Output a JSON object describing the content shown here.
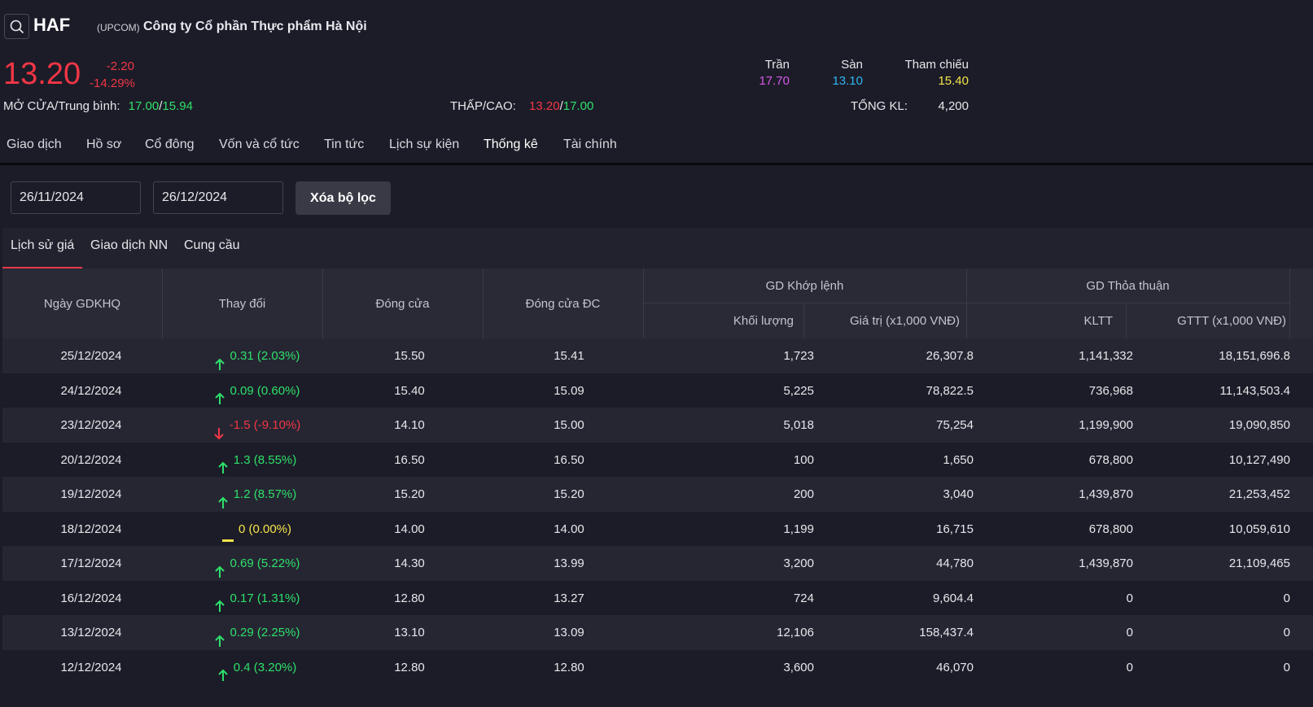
{
  "header": {
    "ticker": "HAF",
    "exchange": "(UPCOM)",
    "company": "Công ty Cổ phần Thực phẩm Hà Nội",
    "price": "13.20",
    "change": "-2.20",
    "change_pct": "-14.29%",
    "open_avg_label": "MỞ CỬA/Trung bình:",
    "open": "17.00",
    "sep": "/",
    "avg": "15.94",
    "lowhigh_label": "THẤP/CAO:",
    "low": "13.20",
    "high": "17.00",
    "ceiling_label": "Trần",
    "ceiling": "17.70",
    "floor_label": "Sàn",
    "floor": "13.10",
    "ref_label": "Tham chiếu",
    "ref": "15.40",
    "total_vol_label": "TỔNG KL:",
    "total_vol": "4,200"
  },
  "tabs": [
    "Giao dịch",
    "Hồ sơ",
    "Cổ đông",
    "Vốn và cổ tức",
    "Tin tức",
    "Lịch sự kiện",
    "Thống kê",
    "Tài chính"
  ],
  "active_tab": "Thống kê",
  "filter": {
    "from_date": "26/11/2024",
    "to_date": "26/12/2024",
    "clear_label": "Xóa bộ lọc"
  },
  "subtabs": [
    "Lịch sử giá",
    "Giao dịch NN",
    "Cung cầu"
  ],
  "table": {
    "headers": {
      "date": "Ngày GDKHQ",
      "change": "Thay đổi",
      "close": "Đóng cửa",
      "close_adj": "Đóng cửa ĐC",
      "match_group": "GD Khớp lệnh",
      "volume": "Khối lượng",
      "value": "Giá trị (x1,000 VNĐ)",
      "deal_group": "GD Thỏa thuận",
      "kltt": "KLTT",
      "gttt": "GTTT (x1,000 VNĐ)"
    },
    "rows": [
      {
        "date": "25/12/2024",
        "dir": "up",
        "change": "0.31 (2.03%)",
        "close": "15.50",
        "close_adj": "15.41",
        "volume": "1,723",
        "value": "26,307.8",
        "kltt": "1,141,332",
        "gttt": "18,151,696.8"
      },
      {
        "date": "24/12/2024",
        "dir": "up",
        "change": "0.09 (0.60%)",
        "close": "15.40",
        "close_adj": "15.09",
        "volume": "5,225",
        "value": "78,822.5",
        "kltt": "736,968",
        "gttt": "11,143,503.4"
      },
      {
        "date": "23/12/2024",
        "dir": "down",
        "change": "-1.5 (-9.10%)",
        "close": "14.10",
        "close_adj": "15.00",
        "volume": "5,018",
        "value": "75,254",
        "kltt": "1,199,900",
        "gttt": "19,090,850"
      },
      {
        "date": "20/12/2024",
        "dir": "up",
        "change": "1.3 (8.55%)",
        "close": "16.50",
        "close_adj": "16.50",
        "volume": "100",
        "value": "1,650",
        "kltt": "678,800",
        "gttt": "10,127,490"
      },
      {
        "date": "19/12/2024",
        "dir": "up",
        "change": "1.2 (8.57%)",
        "close": "15.20",
        "close_adj": "15.20",
        "volume": "200",
        "value": "3,040",
        "kltt": "1,439,870",
        "gttt": "21,253,452"
      },
      {
        "date": "18/12/2024",
        "dir": "flat",
        "change": "0 (0.00%)",
        "close": "14.00",
        "close_adj": "14.00",
        "volume": "1,199",
        "value": "16,715",
        "kltt": "678,800",
        "gttt": "10,059,610"
      },
      {
        "date": "17/12/2024",
        "dir": "up",
        "change": "0.69 (5.22%)",
        "close": "14.30",
        "close_adj": "13.99",
        "volume": "3,200",
        "value": "44,780",
        "kltt": "1,439,870",
        "gttt": "21,109,465"
      },
      {
        "date": "16/12/2024",
        "dir": "up",
        "change": "0.17 (1.31%)",
        "close": "12.80",
        "close_adj": "13.27",
        "volume": "724",
        "value": "9,604.4",
        "kltt": "0",
        "gttt": "0"
      },
      {
        "date": "13/12/2024",
        "dir": "up",
        "change": "0.29 (2.25%)",
        "close": "13.10",
        "close_adj": "13.09",
        "volume": "12,106",
        "value": "158,437.4",
        "kltt": "0",
        "gttt": "0"
      },
      {
        "date": "12/12/2024",
        "dir": "up",
        "change": "0.4 (3.20%)",
        "close": "12.80",
        "close_adj": "12.80",
        "volume": "3,600",
        "value": "46,070",
        "kltt": "0",
        "gttt": "0"
      }
    ]
  },
  "icons": {
    "search": "search-icon",
    "up": "arrow-up-icon",
    "down": "arrow-down-icon",
    "flat": "flat-dash-icon"
  },
  "colors": {
    "up": "#2ee06a",
    "down": "#f23645",
    "flat": "#f5e44a",
    "ceiling": "#d657e8",
    "floor": "#2fb7f0",
    "ref": "#f5e44a"
  }
}
